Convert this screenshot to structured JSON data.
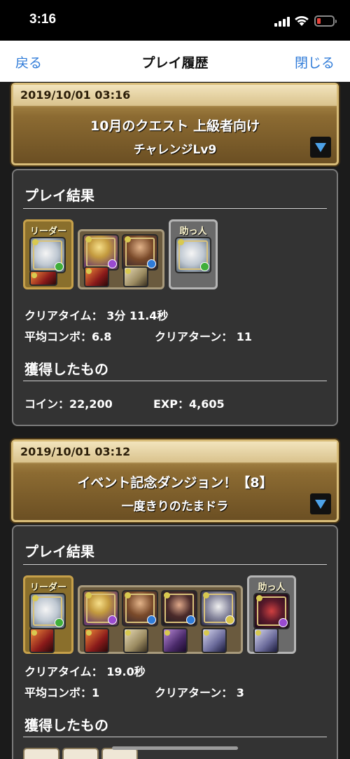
{
  "status_bar": {
    "time": "3:16"
  },
  "nav": {
    "back_label": "戻る",
    "title": "プレイ履歴",
    "close_label": "閉じる"
  },
  "entries": [
    {
      "datetime": "2019/10/01 03:16",
      "quest_name": "10月のクエスト 上級者向け",
      "quest_sub": "チャレンジLv9",
      "result_title": "プレイ結果",
      "leader_label": "リーダー",
      "helper_label": "助っ人",
      "clear_time": "クリアタイム： 3分 11.4秒",
      "avg_combo": "平均コンボ：6.8",
      "clear_turns": "クリアターン： 11",
      "obtained_title": "獲得したもの",
      "coins": "コイン：22,200",
      "exp": "EXP：4,605"
    },
    {
      "datetime": "2019/10/01 03:12",
      "quest_name": "イベント記念ダンジョン！【8】",
      "quest_sub": "一度きりのたまドラ",
      "result_title": "プレイ結果",
      "leader_label": "リーダー",
      "helper_label": "助っ人",
      "clear_time": "クリアタイム： 19.0秒",
      "avg_combo": "平均コンボ：1",
      "clear_turns": "クリアターン： 3",
      "obtained_title": "獲得したもの"
    }
  ],
  "colors": {
    "accent": "#2f7bd8",
    "header_gold": "#c6a560",
    "card_bg": "#333333",
    "battery_low": "#e8433b"
  },
  "icons": [
    "signal-icon",
    "wifi-icon",
    "battery-icon",
    "expand-arrow-icon",
    "monster-icon",
    "assist-equip-icon",
    "attribute-orb-icon",
    "reward-item-icon"
  ]
}
